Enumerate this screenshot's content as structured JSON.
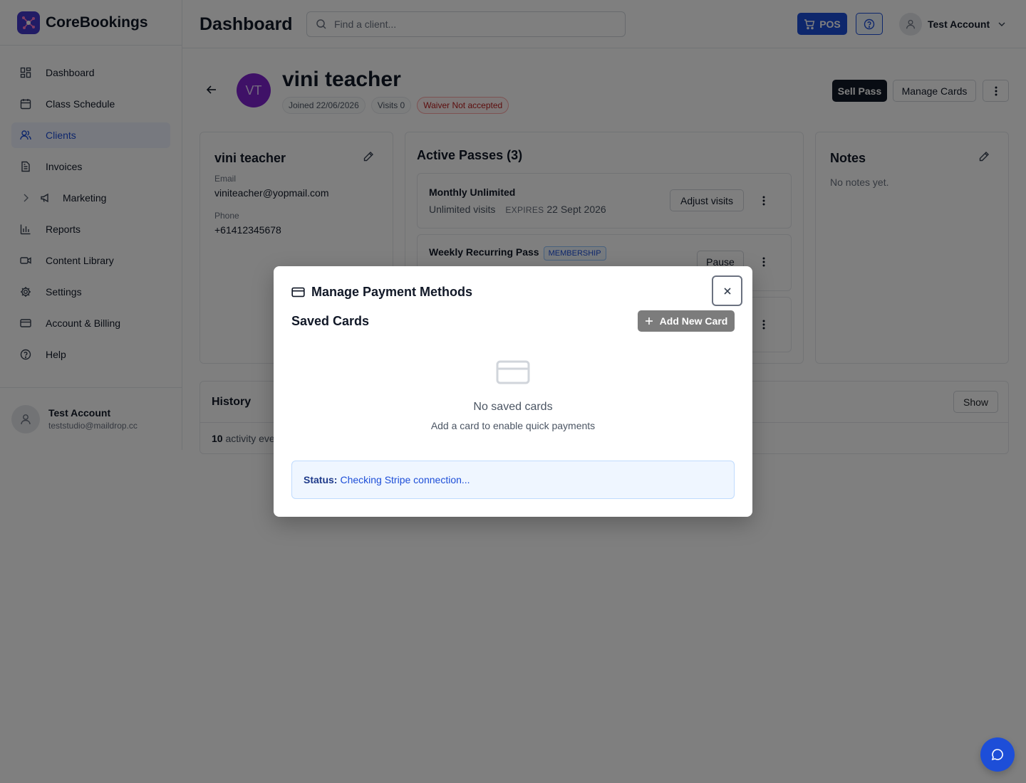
{
  "brand": {
    "name": "CoreBookings"
  },
  "sidebar": {
    "items": [
      {
        "label": "Dashboard",
        "icon": "layout-grid-icon"
      },
      {
        "label": "Class Schedule",
        "icon": "calendar-icon"
      },
      {
        "label": "Clients",
        "icon": "users-icon",
        "active": true
      },
      {
        "label": "Invoices",
        "icon": "file-text-icon"
      },
      {
        "label": "Marketing",
        "icon": "megaphone-icon",
        "expandable": true
      },
      {
        "label": "Reports",
        "icon": "bar-chart-icon"
      },
      {
        "label": "Content Library",
        "icon": "video-icon"
      },
      {
        "label": "Settings",
        "icon": "gear-icon"
      },
      {
        "label": "Account & Billing",
        "icon": "credit-card-icon"
      },
      {
        "label": "Help",
        "icon": "help-circle-icon"
      }
    ],
    "user": {
      "name": "Test Account",
      "email": "teststudio@maildrop.cc"
    }
  },
  "header": {
    "title": "Dashboard",
    "search_placeholder": "Find a client...",
    "pos_label": "POS",
    "account_label": "Test Account"
  },
  "client": {
    "initials": "VT",
    "name": "vini teacher",
    "joined": "Joined 22/06/2026",
    "visits": "Visits 0",
    "waiver": "Waiver Not accepted",
    "actions": {
      "sell": "Sell Pass",
      "manage": "Manage Cards"
    }
  },
  "info": {
    "name": "vini teacher",
    "email_label": "Email",
    "email": "viniteacher@yopmail.com",
    "phone_label": "Phone",
    "phone": "+61412345678"
  },
  "passes": {
    "title": "Active Passes (3)",
    "items": [
      {
        "name": "Monthly Unlimited",
        "sub": "Unlimited visits",
        "expires_label": "EXPIRES",
        "expires": "22 Sept 2026",
        "action": "Adjust visits"
      },
      {
        "name": "Weekly Recurring Pass",
        "tag": "MEMBERSHIP",
        "action": "Pause"
      }
    ]
  },
  "notes": {
    "title": "Notes",
    "empty": "No notes yet."
  },
  "history": {
    "title": "History",
    "count": "10",
    "count_text": "activity eve",
    "show_label": "Show"
  },
  "modal": {
    "title": "Manage Payment Methods",
    "close_label": "×",
    "saved_title": "Saved Cards",
    "add_label": "Add New Card",
    "empty_title": "No saved cards",
    "empty_sub": "Add a card to enable quick payments",
    "status_label": "Status:",
    "status_text": "Checking Stripe connection..."
  },
  "colors": {
    "primary": "#1d4ed8",
    "avatar": "#7e22ce",
    "danger": "#b91c1c"
  }
}
